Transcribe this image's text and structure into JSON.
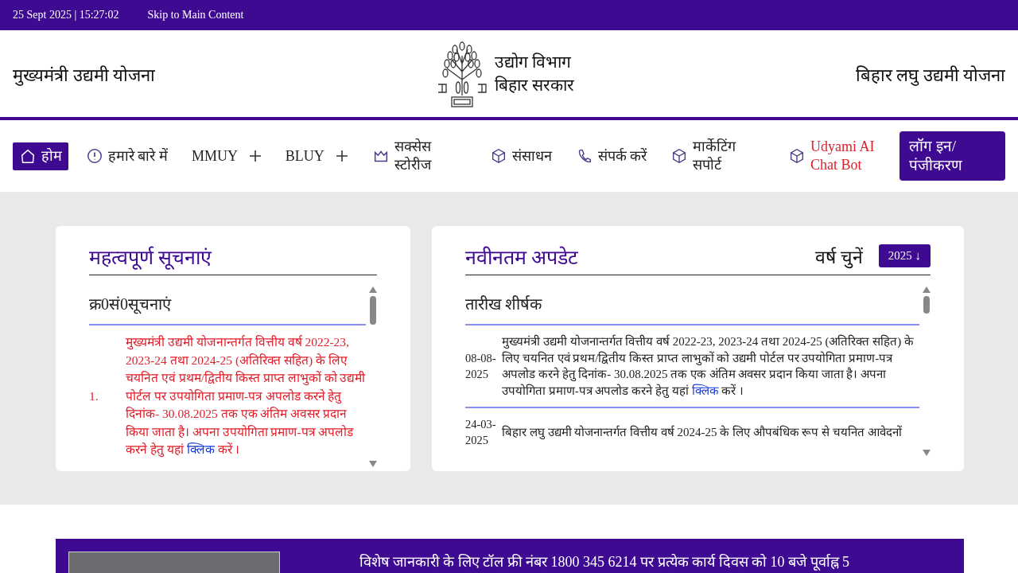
{
  "top_bar": {
    "datetime": "25 Sept 2025 | 15:27:02",
    "skip_link": "Skip to Main Content"
  },
  "header": {
    "left_title": "मुख्यमंत्री उद्यमी योजना",
    "logo_lines": [
      "उद्योग विभाग",
      "बिहार सरकार"
    ],
    "right_title": "बिहार लघु उद्यमी योजना"
  },
  "nav": {
    "items": [
      {
        "label": "होम",
        "selected": true,
        "expandable": false
      },
      {
        "label": "हमारे बारे में",
        "selected": false,
        "expandable": false,
        "color": "#222222"
      },
      {
        "label": "MMUY",
        "selected": false,
        "expandable": true,
        "color": "#222222"
      },
      {
        "label": "BLUY",
        "selected": false,
        "expandable": true,
        "color": "#222222"
      },
      {
        "label": "सक्सेस स्टोरीज",
        "selected": false,
        "expandable": false,
        "color": "#222222"
      },
      {
        "label": "संसाधन",
        "selected": false,
        "expandable": false,
        "color": "#222222"
      },
      {
        "label": "संपर्क करें",
        "selected": false,
        "expandable": false,
        "color": "#222222"
      },
      {
        "label": "मार्केटिंग सपोर्ट",
        "selected": false,
        "expandable": false,
        "color": "#222222"
      },
      {
        "label": "Udyami AI Chat Bot",
        "selected": false,
        "expandable": false,
        "color": "#e0202c"
      }
    ],
    "login_button": "लॉग इन/ पंजीकरण"
  },
  "notices": {
    "title": "महत्वपूर्ण सूचनाएं",
    "header": "क्र0सं0सूचनाएं",
    "rows": [
      {
        "number": "1.",
        "text_before": "मुख्यमंत्री उद्यमी योजनान्तर्गत वित्तीय वर्ष 2022-23, 2023-24 तथा 2024-25 (अतिरिक्त सहित) के लिए चयनित एवं प्रथम/द्वितीय किस्त प्राप्त लाभुकों को उद्यमी पोर्टल पर उपयोगिता प्रमाण-पत्र अपलोड करने हेतु दिनांक- 30.08.2025 तक एक अंतिम अवसर प्रदान किया जाता है। अपना उपयोगिता प्रमाण-पत्र अपलोड करने हेतु यहां",
        "link": "क्लिक",
        "text_after": "करें ।"
      }
    ]
  },
  "updates": {
    "title": "नवीनतम अपडेट",
    "year_label": "वर्ष चुनें",
    "year_button": "2025 ↓",
    "header": "तारीख शीर्षक",
    "rows": [
      {
        "date": "08-08-2025",
        "text_before": "मुख्यमंत्री उद्यमी योजनान्तर्गत वित्तीय वर्ष 2022-23, 2023-24 तथा 2024-25 (अतिरिक्त सहित) के लिए चयनित एवं प्रथम/द्वितीय किस्त प्राप्त लाभुकों को उद्यमी पोर्टल पर उपयोगिता प्रमाण-पत्र अपलोड करने हेतु दिनांक- 30.08.2025 तक एक अंतिम अवसर प्रदान किया जाता है। अपना उपयोगिता प्रमाण-पत्र अपलोड करने हेतु यहां",
        "link": "क्लिक",
        "text_after": "करें ।"
      },
      {
        "date": "24-03-2025",
        "text_before": "बिहार लघु उद्यमी योजनान्तर्गत वित्तीय वर्ष 2024-25 के लिए औपबंधिक रूप से चयनित आवेदनों"
      }
    ]
  },
  "banner": {
    "text": "विशेष जानकारी के लिए टॉल फ्री नंबर 1800 345 6214 पर प्रत्येक कार्य दिवस को 10 बजे पूर्वाह्न 5"
  }
}
